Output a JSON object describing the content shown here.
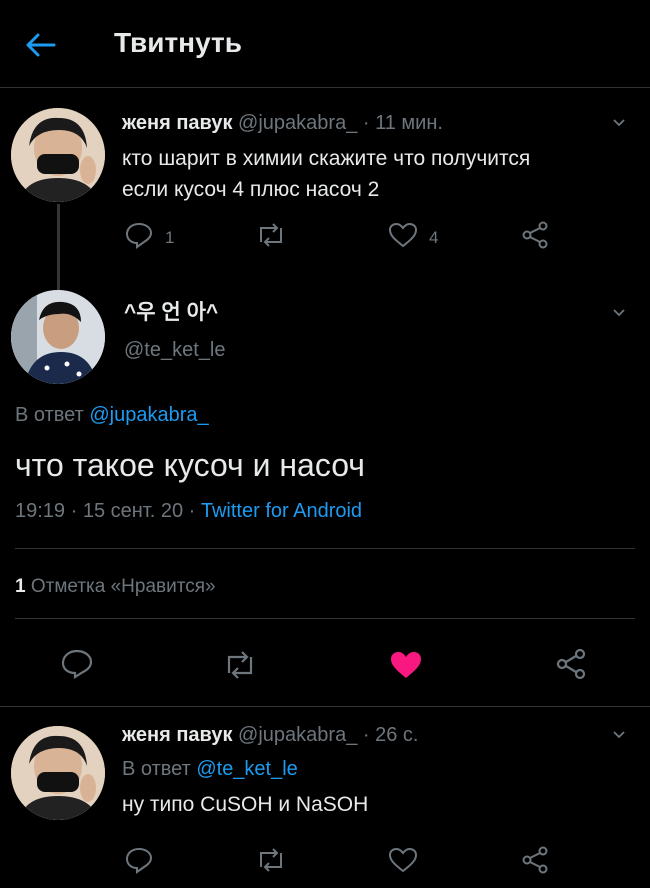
{
  "header": {
    "title": "Твитнуть"
  },
  "tweet1": {
    "name": "женя павук",
    "handle": "@jupakabra_",
    "time": "· 11 мин.",
    "text_line1": "кто шарит в химии скажите что получится",
    "text_line2": "если кусоч 4 плюс насоч 2",
    "reply_count": "1",
    "like_count": "4"
  },
  "main_tweet": {
    "name": "^우 언 아^",
    "handle": "@te_ket_le",
    "reply_to_prefix": "В ответ",
    "reply_to_handle": "@jupakabra_",
    "text": "что такое кусоч и насоч",
    "datetime": "19:19 · 15 сент. 20 ·",
    "client": "Twitter for Android",
    "likes_number": "1",
    "likes_label": "Отметка «Нравится»"
  },
  "reply": {
    "name": "женя павук",
    "handle": "@jupakabra_",
    "time": "· 26 с.",
    "reply_to_prefix": "В ответ",
    "reply_to_handle": "@te_ket_le",
    "text": "ну типо CuSOH и NaSOH"
  },
  "colors": {
    "background": "#000000",
    "accent": "#1d9bf0",
    "like_active": "#f91880",
    "muted": "#6e767d"
  },
  "icons": [
    "back-arrow-icon",
    "reply-icon",
    "retweet-icon",
    "like-icon",
    "share-icon",
    "chevron-down-icon"
  ]
}
